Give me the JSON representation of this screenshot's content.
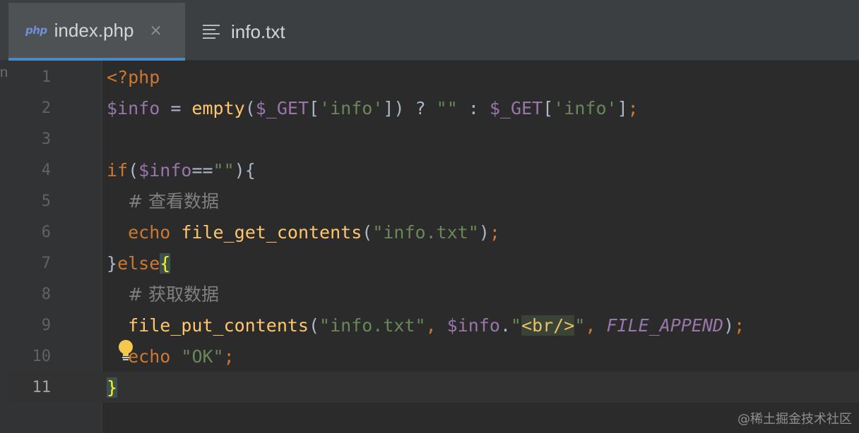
{
  "tabs": [
    {
      "icon": "php",
      "label": "index.php",
      "active": true,
      "close": "×"
    },
    {
      "icon": "text-file-icon",
      "label": "info.txt",
      "active": false
    }
  ],
  "gutter_clip": "nc",
  "line_numbers": [
    "1",
    "2",
    "3",
    "4",
    "5",
    "6",
    "7",
    "8",
    "9",
    "10",
    "11"
  ],
  "current_line": "11",
  "code": {
    "l1": {
      "open_tag": "<?php"
    },
    "l2": {
      "var": "$info",
      "eq": " = ",
      "fn": "empty",
      "p1": "(",
      "get": "$_GET",
      "b1": "[",
      "key": "'info'",
      "b2": "]",
      "p2": ")",
      "tern": " ? ",
      "empty_str": "\"\"",
      "colon": " : ",
      "get2": "$_GET",
      "b3": "[",
      "key2": "'info'",
      "b4": "]",
      "semi": ";"
    },
    "l4": {
      "if": "if",
      "p1": "(",
      "var": "$info",
      "op": "==",
      "str": "\"\"",
      "p2": ")",
      "brace": "{"
    },
    "l5": {
      "comment": "# 查看数据"
    },
    "l6": {
      "echo": "echo",
      "fn": "file_get_contents",
      "p1": "(",
      "str": "\"info.txt\"",
      "p2": ")",
      "semi": ";"
    },
    "l7": {
      "close": "}",
      "else": "else",
      "brace": "{"
    },
    "l8": {
      "comment": "# 获取数据"
    },
    "l9": {
      "fn": "file_put_contents",
      "p1": "(",
      "str1": "\"info.txt\"",
      "comma1": ", ",
      "var": "$info",
      "dot": ".",
      "q1": "\"",
      "tag": "<br/>",
      "q2": "\"",
      "comma2": ", ",
      "const": "FILE_APPEND",
      "p2": ")",
      "semi": ";"
    },
    "l10": {
      "echo": "echo",
      "str": "\"OK\"",
      "semi": ";"
    },
    "l11": {
      "brace": "}"
    }
  },
  "watermark": "@稀土掘金技术社区"
}
